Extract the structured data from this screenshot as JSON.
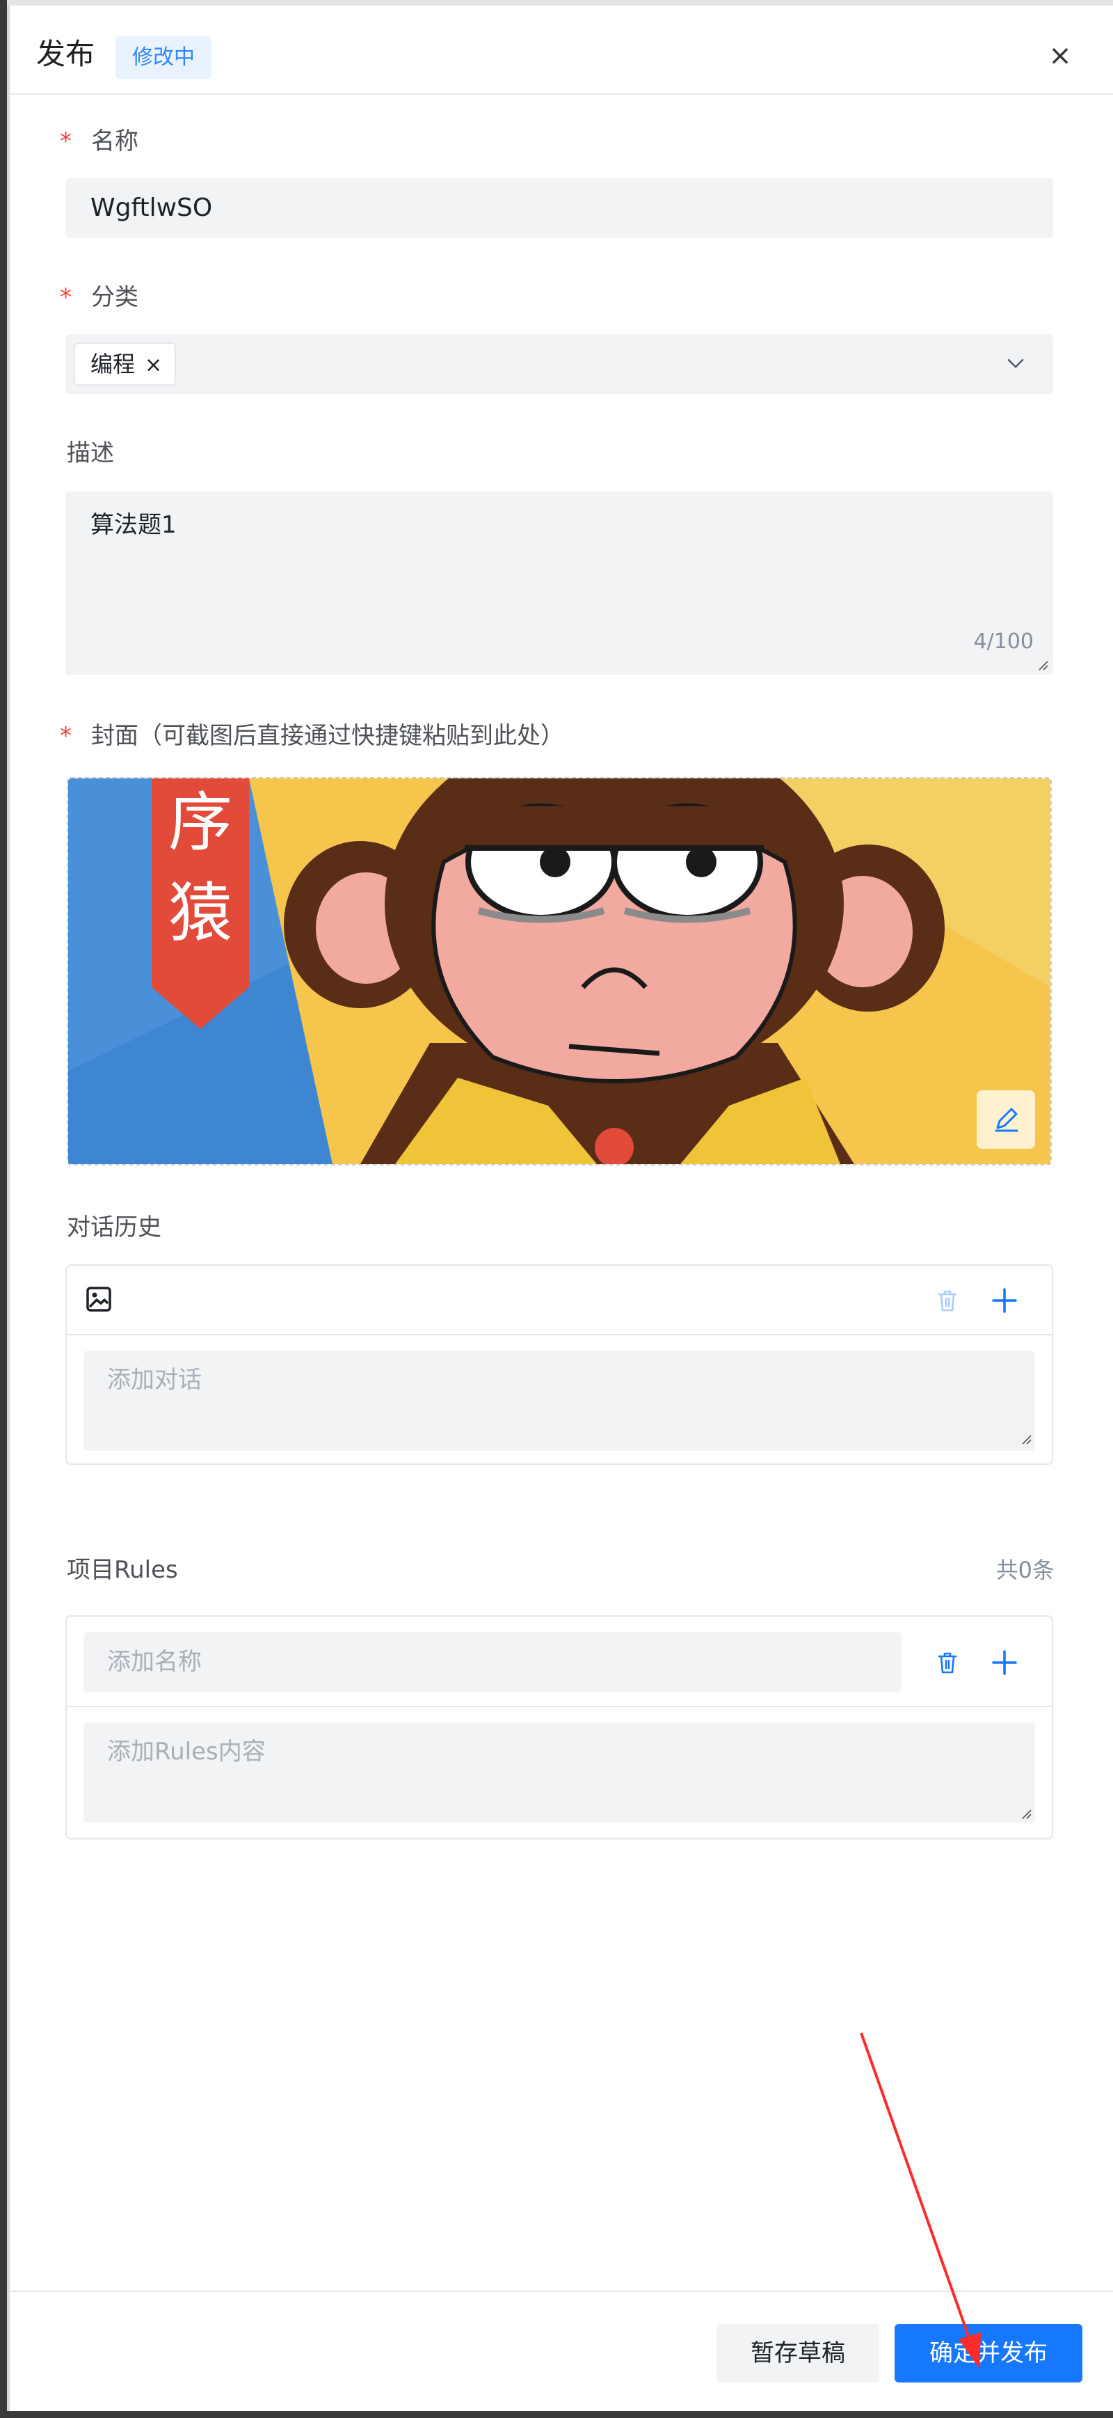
{
  "header": {
    "title": "发布",
    "status_badge": "修改中",
    "close_label": "×"
  },
  "form": {
    "name": {
      "label": "名称",
      "required": "*",
      "value": "WgftlwSO"
    },
    "category": {
      "label": "分类",
      "required": "*",
      "tags": [
        "编程"
      ],
      "tag_close": "×"
    },
    "description": {
      "label": "描述",
      "value": "算法题1",
      "count": "4/100"
    },
    "cover": {
      "label": "封面（可截图后直接通过快捷键粘贴到此处）",
      "required": "*",
      "image_text": "序猿"
    },
    "chat_history": {
      "label": "对话历史",
      "placeholder": "添加对话"
    },
    "rules": {
      "label": "项目Rules",
      "count": "共0条",
      "name_placeholder": "添加名称",
      "content_placeholder": "添加Rules内容"
    }
  },
  "footer": {
    "draft_label": "暂存草稿",
    "publish_label": "确定并发布"
  },
  "colors": {
    "primary": "#1677ff",
    "badge_bg": "#e8f3ff",
    "required": "#f53f3f",
    "field_bg": "#f2f3f5",
    "annotation_arrow": "#ff2a2a"
  }
}
